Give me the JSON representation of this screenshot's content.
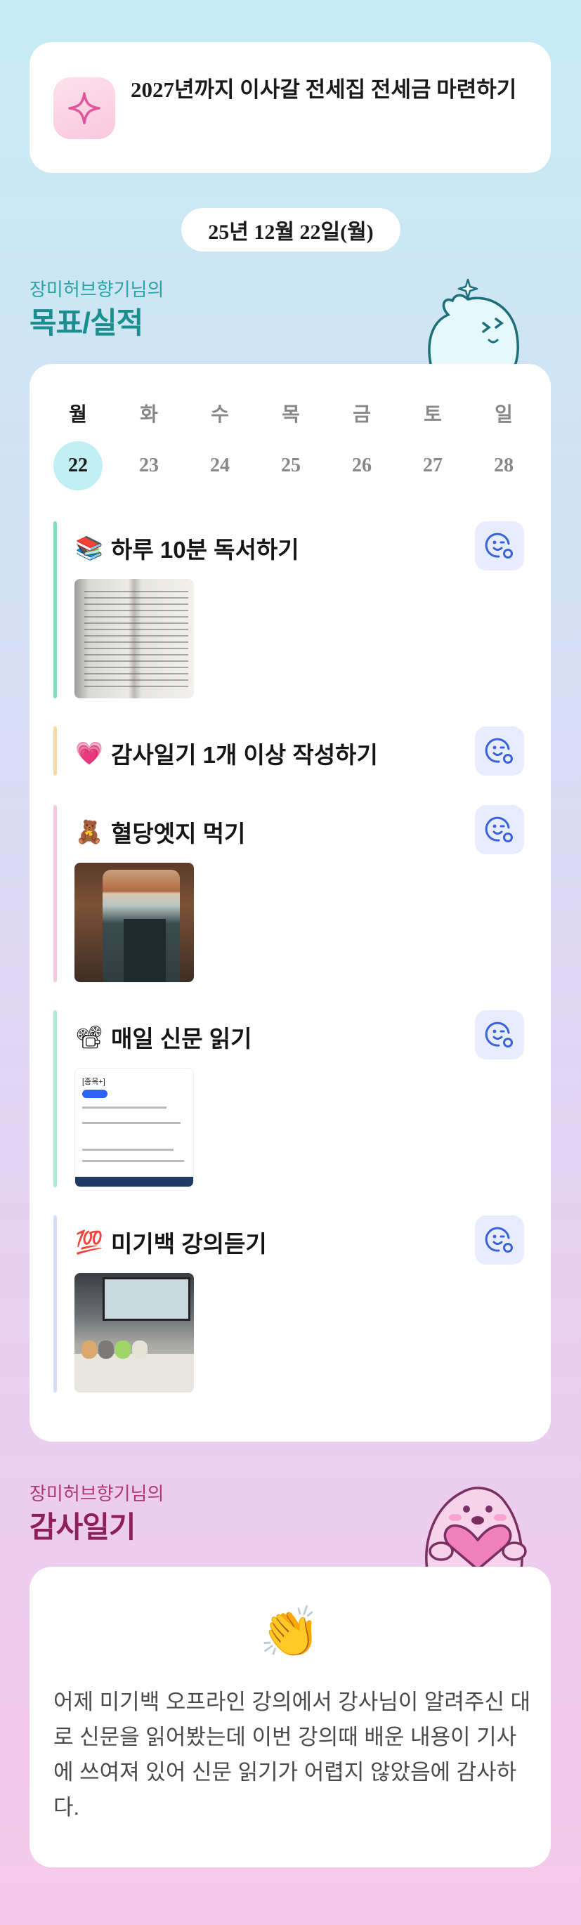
{
  "goal_header": {
    "text": "2027년까지 이사갈 전세집 전세금 마련하기",
    "icon": "sparkle-icon"
  },
  "date_label": "25년 12월 22일(월)",
  "goals_section": {
    "subtitle": "장미허브향기님의",
    "title": "목표/실적",
    "weekdays": [
      "월",
      "화",
      "수",
      "목",
      "금",
      "토",
      "일"
    ],
    "days": [
      "22",
      "23",
      "24",
      "25",
      "26",
      "27",
      "28"
    ],
    "selected_day": "22",
    "items": [
      {
        "emoji": "📚",
        "title": "하루 10분 독서하기",
        "bar_color": "#7fe0c0",
        "has_photo": true,
        "photo": "book-page-photo"
      },
      {
        "emoji": "💗",
        "title": "감사일기 1개 이상 작성하기",
        "bar_color": "#f7d9a8",
        "has_photo": false
      },
      {
        "emoji": "🧸",
        "title": "혈당엣지 먹기",
        "bar_color": "#f6c6e2",
        "has_photo": true,
        "photo": "bottle-photo"
      },
      {
        "emoji": "📽",
        "title": "매일 신문 읽기",
        "bar_color": "#a6ecd2",
        "has_photo": true,
        "photo": "news-screenshot",
        "photo_text": "[종목+]"
      },
      {
        "emoji": "💯",
        "title": "미기백 강의듣기",
        "bar_color": "#d4dcf7",
        "has_photo": true,
        "photo": "lecture-photo"
      }
    ],
    "react_icon": "smile-add-icon"
  },
  "diary_section": {
    "subtitle": "장미허브향기님의",
    "title": "감사일기",
    "emoji": "👏",
    "text": "어제 미기백 오프라인 강의에서 강사님이 알려주신 대로 신문을 읽어봤는데 이번 강의때 배운 내용이 기사에 쓰여져 있어 신문 읽기가 어렵지 않았음에 감사하다."
  },
  "colors": {
    "accent_teal": "#1b8e8f",
    "accent_magenta": "#8e1f5d",
    "selected_day_bg": "#c2eff4",
    "react_bg": "#e7ecfe",
    "react_icon": "#3a63d8"
  }
}
